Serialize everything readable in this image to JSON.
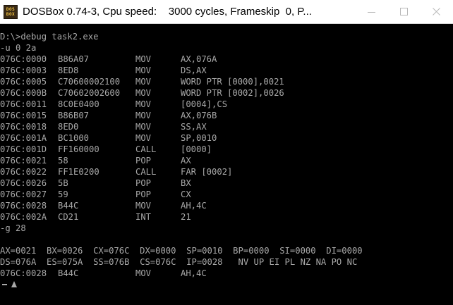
{
  "window": {
    "title": "DOSBox 0.74-3, Cpu speed:    3000 cycles, Frameskip  0, P...",
    "icon_text_top": "DOS",
    "icon_text_bottom": "BOX",
    "controls": [
      "minimize-icon",
      "maximize-icon",
      "close-icon"
    ]
  },
  "console": {
    "command": "D:\\>debug task2.exe",
    "unassemble_cmd": "-u 0 2a",
    "listing": [
      {
        "addr": "076C:0000",
        "bytes": "B86A07",
        "mnemonic": "MOV",
        "operands": "AX,076A"
      },
      {
        "addr": "076C:0003",
        "bytes": "8ED8",
        "mnemonic": "MOV",
        "operands": "DS,AX"
      },
      {
        "addr": "076C:0005",
        "bytes": "C70600002100",
        "mnemonic": "MOV",
        "operands": "WORD PTR [0000],0021"
      },
      {
        "addr": "076C:000B",
        "bytes": "C70602002600",
        "mnemonic": "MOV",
        "operands": "WORD PTR [0002],0026"
      },
      {
        "addr": "076C:0011",
        "bytes": "8C0E0400",
        "mnemonic": "MOV",
        "operands": "[0004],CS"
      },
      {
        "addr": "076C:0015",
        "bytes": "B86B07",
        "mnemonic": "MOV",
        "operands": "AX,076B"
      },
      {
        "addr": "076C:0018",
        "bytes": "8ED0",
        "mnemonic": "MOV",
        "operands": "SS,AX"
      },
      {
        "addr": "076C:001A",
        "bytes": "BC1000",
        "mnemonic": "MOV",
        "operands": "SP,0010"
      },
      {
        "addr": "076C:001D",
        "bytes": "FF160000",
        "mnemonic": "CALL",
        "operands": "[0000]"
      },
      {
        "addr": "076C:0021",
        "bytes": "58",
        "mnemonic": "POP",
        "operands": "AX"
      },
      {
        "addr": "076C:0022",
        "bytes": "FF1E0200",
        "mnemonic": "CALL",
        "operands": "FAR [0002]"
      },
      {
        "addr": "076C:0026",
        "bytes": "5B",
        "mnemonic": "POP",
        "operands": "BX"
      },
      {
        "addr": "076C:0027",
        "bytes": "59",
        "mnemonic": "POP",
        "operands": "CX"
      },
      {
        "addr": "076C:0028",
        "bytes": "B44C",
        "mnemonic": "MOV",
        "operands": "AH,4C"
      },
      {
        "addr": "076C:002A",
        "bytes": "CD21",
        "mnemonic": "INT",
        "operands": "21"
      }
    ],
    "go_cmd": "-g 28",
    "registers_line1": "AX=0021  BX=0026  CX=076C  DX=0000  SP=0010  BP=0000  SI=0000  DI=0000",
    "registers_line2": "DS=076A  ES=075A  SS=076B  CS=076C  IP=0028   NV UP EI PL NZ NA PO NC",
    "current": {
      "addr": "076C:0028",
      "bytes": "B44C",
      "mnemonic": "MOV",
      "operands": "AH,4C"
    },
    "text_color": "#a8a8a8",
    "background_color": "#000000"
  }
}
